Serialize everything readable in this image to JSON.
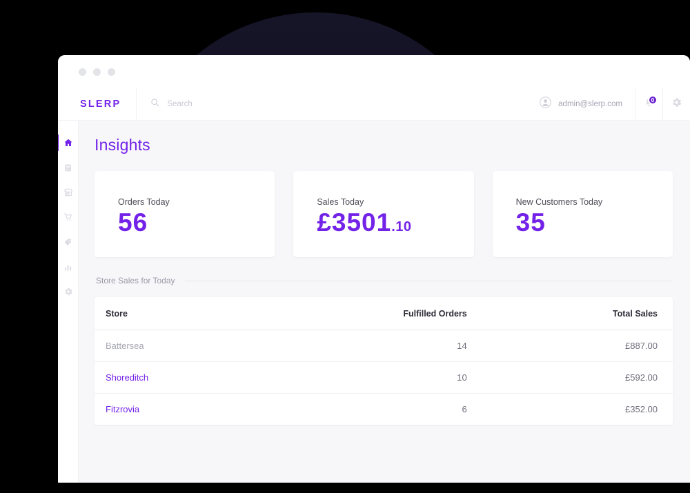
{
  "window": {
    "dots": [
      "dot-red",
      "dot-yellow",
      "dot-green"
    ]
  },
  "header": {
    "brand": "SLERP",
    "search": {
      "icon": "search-icon",
      "placeholder": "Search",
      "value": ""
    },
    "user": {
      "avatar_icon": "user-avatar-icon",
      "email": "admin@slerp.com"
    },
    "notifications": {
      "icon": "bell-icon",
      "badge_count": "0"
    },
    "settings": {
      "icon": "gear-icon"
    }
  },
  "sidebar": {
    "items": [
      {
        "name": "home",
        "icon": "home-icon",
        "active": true
      },
      {
        "name": "orders",
        "icon": "document-icon",
        "active": false
      },
      {
        "name": "stores",
        "icon": "store-icon",
        "active": false
      },
      {
        "name": "cart",
        "icon": "cart-icon",
        "active": false
      },
      {
        "name": "products",
        "icon": "tag-icon",
        "active": false
      },
      {
        "name": "reports",
        "icon": "bar-chart-icon",
        "active": false
      },
      {
        "name": "settings",
        "icon": "gear-icon",
        "active": false
      }
    ]
  },
  "main": {
    "title": "Insights",
    "cards": [
      {
        "label": "Orders Today",
        "value": "56",
        "fraction": ""
      },
      {
        "label": "Sales Today",
        "value": "£3501",
        "fraction": ".10"
      },
      {
        "label": "New Customers Today",
        "value": "35",
        "fraction": ""
      }
    ],
    "section": {
      "label": "Store Sales for Today"
    },
    "table": {
      "columns": [
        "Store",
        "Fulfilled Orders",
        "Total Sales"
      ],
      "rows": [
        {
          "store": "Battersea",
          "link": false,
          "orders": "14",
          "sales": "£887.00"
        },
        {
          "store": "Shoreditch",
          "link": true,
          "orders": "10",
          "sales": "£592.00"
        },
        {
          "store": "Fitzrovia",
          "link": true,
          "orders": "6",
          "sales": "£352.00"
        }
      ]
    }
  },
  "colors": {
    "accent": "#7322e8",
    "badge": "#6a1fd0",
    "canvas": "#f7f7fa",
    "backdrop": "#000000",
    "circle": "#161427"
  }
}
